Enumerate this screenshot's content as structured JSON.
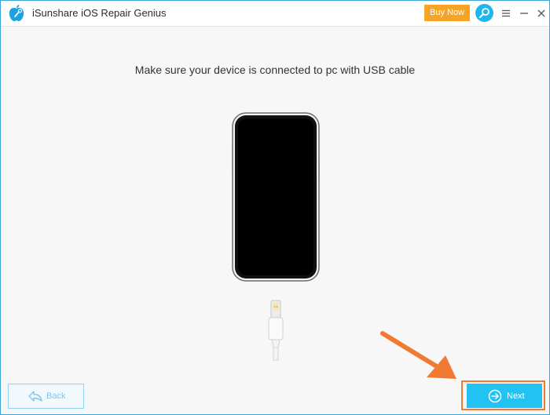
{
  "window": {
    "title": "iSunshare iOS Repair Genius",
    "icons": [
      "apple-wrench-logo",
      "search-icon",
      "menu-icon",
      "minimize-icon",
      "close-icon"
    ]
  },
  "toolbar": {
    "buy_label": "Buy Now"
  },
  "main": {
    "instruction": "Make sure your device is connected to pc with USB cable",
    "cable_label": "USB"
  },
  "footer": {
    "back_label": "Back",
    "next_label": "Next"
  },
  "colors": {
    "accent": "#22c3f3",
    "buy": "#f5a425",
    "highlight": "#f07a32",
    "back_text": "#7fc8ea"
  }
}
